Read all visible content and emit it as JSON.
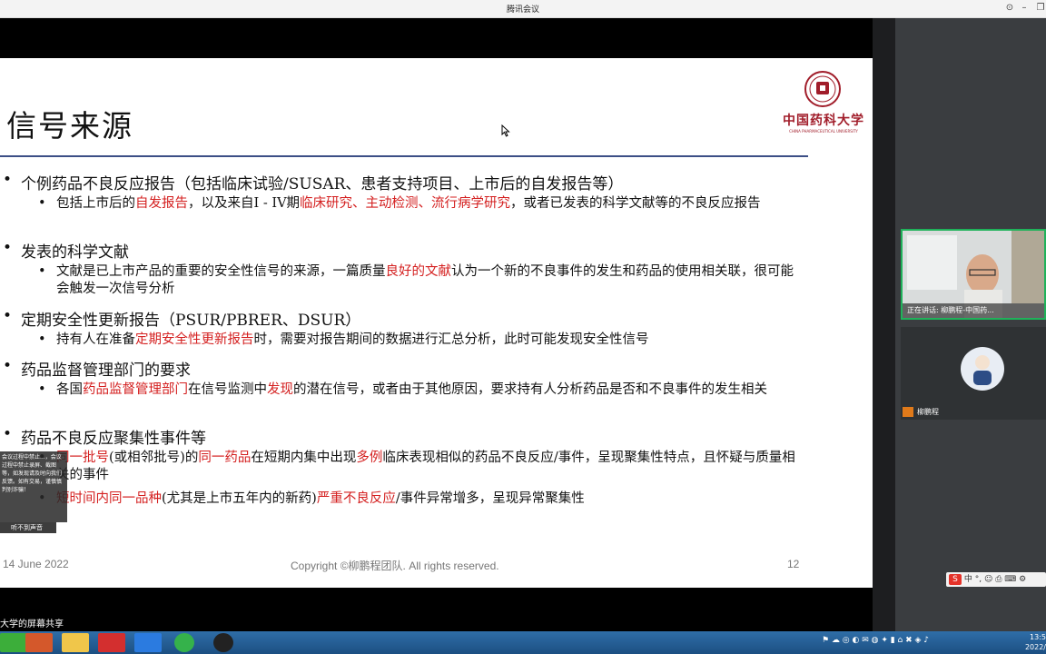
{
  "window": {
    "title": "腾讯会议"
  },
  "slide": {
    "title": "信号来源",
    "logo_text": "中国药科大学",
    "logo_subtext": "CHINA PHARMACEUTICAL UNIVERSITY",
    "bullets": [
      {
        "text": "个例药品不良反应报告（包括临床试验/SUSAR、患者支持项目、上市后的自发报告等）",
        "sub": [
          [
            {
              "t": "包括上市后的",
              "c": "n"
            },
            {
              "t": "自发报告",
              "c": "r"
            },
            {
              "t": "，以及来自I - IV期",
              "c": "n"
            },
            {
              "t": "临床研究、主动检测、流行病学研究",
              "c": "r"
            },
            {
              "t": "，或者已发表的科学文献等的不良反应报告",
              "c": "n"
            }
          ]
        ]
      },
      {
        "text": "发表的科学文献",
        "sub": [
          [
            {
              "t": "文献是已上市产品的重要的安全性信号的来源，一篇质量",
              "c": "n"
            },
            {
              "t": "良好的文献",
              "c": "r"
            },
            {
              "t": "认为一个新的不良事件的发生和药品的使用相关联，很可能会触发一次信号分析",
              "c": "n"
            }
          ]
        ]
      },
      {
        "text": "定期安全性更新报告（PSUR/PBRER、DSUR）",
        "sub": [
          [
            {
              "t": "持有人在准备",
              "c": "n"
            },
            {
              "t": "定期安全性更新报告",
              "c": "r"
            },
            {
              "t": "时，需要对报告期间的数据进行汇总分析，此时可能发现安全性信号",
              "c": "n"
            }
          ]
        ]
      },
      {
        "text": "药品监督管理部门的要求",
        "sub": [
          [
            {
              "t": "各国",
              "c": "n"
            },
            {
              "t": "药品监督管理部门",
              "c": "r"
            },
            {
              "t": "在信号监测中",
              "c": "n"
            },
            {
              "t": "发现",
              "c": "r"
            },
            {
              "t": "的潜在信号，或者由于其他原因，要求持有人分析药品是否和不良事件的发生相关",
              "c": "n"
            }
          ]
        ]
      },
      {
        "text": "药品不良反应聚集性事件等",
        "sub": [
          [
            {
              "t": "同一批号",
              "c": "r"
            },
            {
              "t": "(或相邻批号)的",
              "c": "n"
            },
            {
              "t": "同一药品",
              "c": "r"
            },
            {
              "t": "在短期内集中出现",
              "c": "n"
            },
            {
              "t": "多例",
              "c": "r"
            },
            {
              "t": "临床表现相似的药品不良反应/事件，呈现聚集性特点，且怀疑与质量相关的事件",
              "c": "n"
            }
          ],
          [
            {
              "t": "短时间内同一品种",
              "c": "r"
            },
            {
              "t": "(尤其是上市五年内的新药)",
              "c": "n"
            },
            {
              "t": "严重不良反应",
              "c": "r"
            },
            {
              "t": "/事件异常增多，呈现异常聚集性",
              "c": "n"
            }
          ]
        ]
      }
    ],
    "footer_date": "14 June 2022",
    "footer_copyright": "Copyright ©柳鹏程团队. All rights reserved.",
    "footer_page": "12"
  },
  "share_banner": "大学的屏幕共享",
  "chat_popup": {
    "message": "会议过程中禁止...，会议过程中禁止录屏、截图等，如发现请及时向我们反馈。如有交易，谨慎慎判别诈骗！",
    "reply_label": "听不到声音"
  },
  "participants": [
    {
      "caption": "正在讲话: 柳鹏程-中国药..."
    },
    {
      "caption": "柳鹏程"
    }
  ],
  "ime": {
    "label": "中 °, ☺ ⎙ ⌨ ⚙"
  },
  "taskbar": {
    "clock_time": "13:5",
    "clock_date": "2022/"
  },
  "colors": {
    "title_rule": "#3c4f86",
    "accent_red": "#d42020",
    "active_speaker": "#1fb25a"
  }
}
